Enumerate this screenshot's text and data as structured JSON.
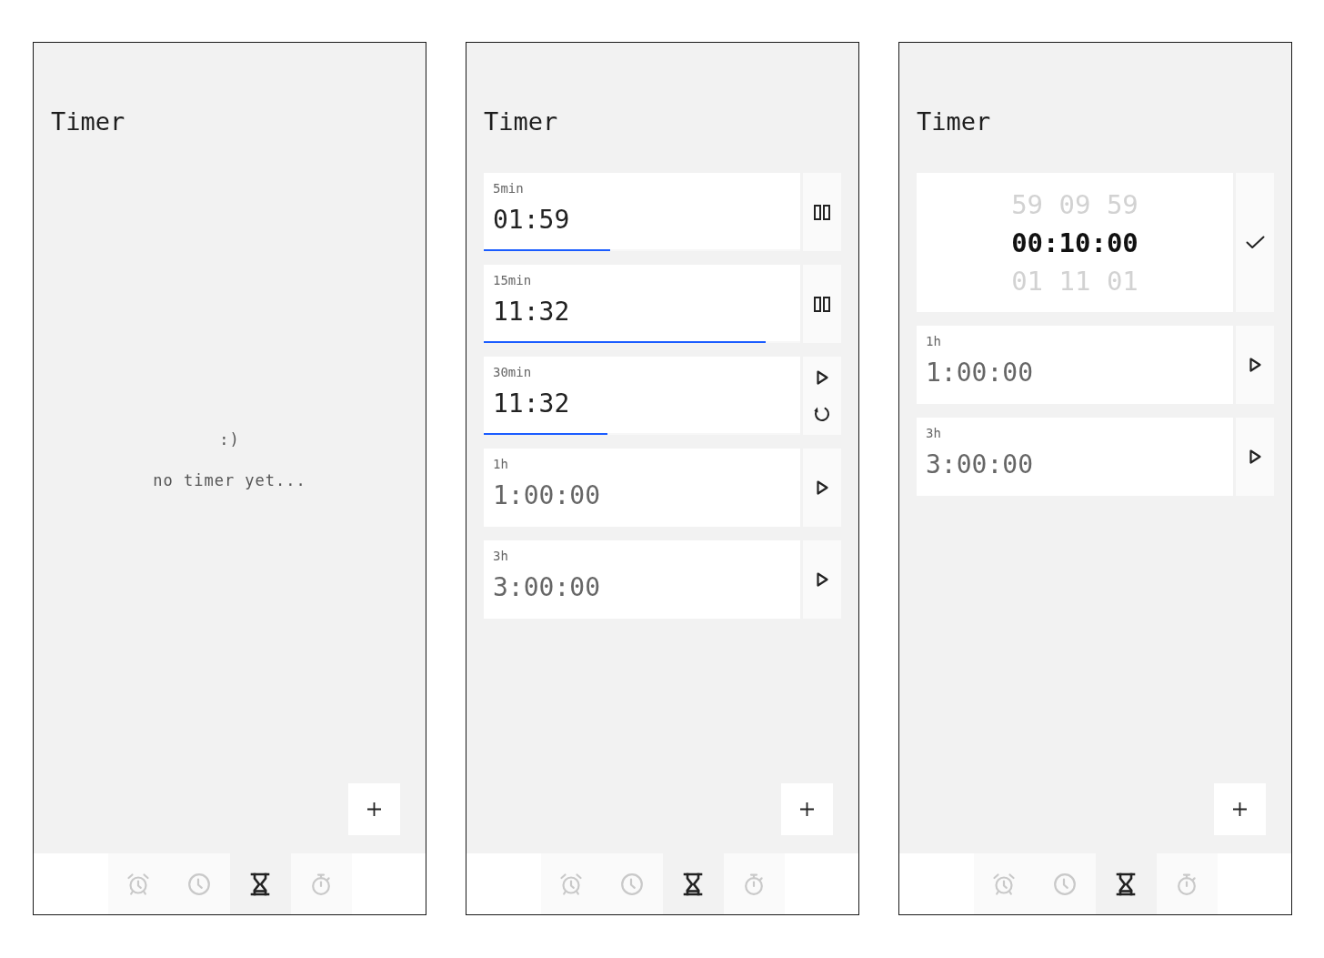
{
  "screens": [
    {
      "title": "Timer",
      "empty_state": {
        "face": ":)",
        "message": "no timer yet..."
      },
      "nav": [
        {
          "kind": "alarm",
          "selected": false
        },
        {
          "kind": "clock",
          "selected": false
        },
        {
          "kind": "timer",
          "selected": true
        },
        {
          "kind": "stopwatch",
          "selected": false
        }
      ]
    },
    {
      "title": "Timer",
      "timers": [
        {
          "label": "5min",
          "time": "01:59",
          "kind": "running",
          "level": 0.4
        },
        {
          "label": "15min",
          "time": "11:32",
          "kind": "running",
          "level": 0.89
        },
        {
          "label": "30min",
          "time": "11:32",
          "kind": "paused",
          "level": 0.39
        },
        {
          "label": "1h",
          "time": "1:00:00",
          "kind": "idle"
        },
        {
          "label": "3h",
          "time": "3:00:00",
          "kind": "idle"
        }
      ],
      "nav": [
        {
          "kind": "alarm",
          "selected": false
        },
        {
          "kind": "clock",
          "selected": false
        },
        {
          "kind": "timer",
          "selected": true
        },
        {
          "kind": "stopwatch",
          "selected": false
        }
      ]
    },
    {
      "title": "Timer",
      "new_timer": {
        "above": [
          "59",
          "09",
          "59"
        ],
        "value": "00:10:00",
        "below": [
          "01",
          "11",
          "01"
        ]
      },
      "timers": [
        {
          "label": "1h",
          "time": "1:00:00",
          "kind": "idle"
        },
        {
          "label": "3h",
          "time": "3:00:00",
          "kind": "idle"
        }
      ],
      "nav": [
        {
          "kind": "alarm",
          "selected": false
        },
        {
          "kind": "clock",
          "selected": false
        },
        {
          "kind": "timer",
          "selected": true
        },
        {
          "kind": "stopwatch",
          "selected": false
        }
      ]
    }
  ]
}
